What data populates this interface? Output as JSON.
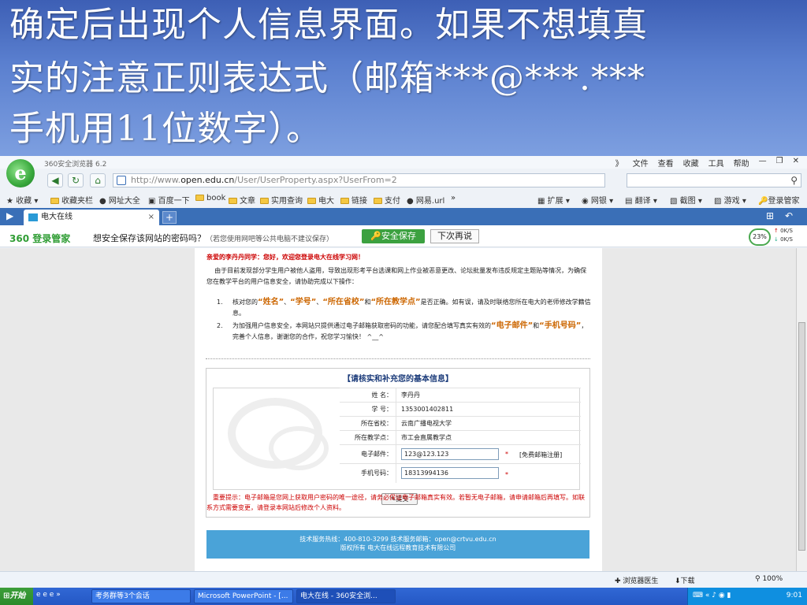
{
  "slide": {
    "line1": "确定后出现个人信息界面。如果不想填真",
    "line2": "实的注意正则表达式（邮箱***@***.***",
    "line3": "手机用11位数字）。"
  },
  "browser": {
    "app_name": "360安全浏览器 6.2",
    "menus": [
      "》",
      "文件",
      "查看",
      "收藏",
      "工具",
      "帮助"
    ],
    "url_prefix": "http://www.",
    "url_host": "open.edu.cn",
    "url_path": "/User/UserProperty.aspx?UserFrom=2",
    "search_placeholder": ""
  },
  "favbar": {
    "items": [
      "收藏",
      "收藏夹栏",
      "网址大全",
      "百度一下",
      "book",
      "文章",
      "实用查询",
      "电大",
      "链接",
      "支付",
      "网易.url",
      "»"
    ],
    "right_items": [
      "扩展",
      "网银",
      "翻译",
      "截图",
      "游戏",
      "登录管家"
    ]
  },
  "tab": {
    "label": "电大在线",
    "close": "×",
    "new": "+"
  },
  "notify": {
    "brand": "360 登录管家",
    "message": "想安全保存该网站的密码吗？",
    "hint": "（若您使用网吧等公共电脑不建议保存）",
    "save_label": "安全保存",
    "later_label": "下次再说",
    "speed_percent": "23%",
    "up_rate": "0K/S",
    "down_rate": "0K/S"
  },
  "page": {
    "welcome": "亲爱的李丹丹同学：您好，欢迎您登录电大在线学习网！",
    "intro": "由于目前发现部分学生用户被他人盗用，导致出现形考平台选课和网上作业被恶意更改、论坛批量发布违反规定主题贴等情况，为确保您在教学平台的用户信息安全，请协助完成以下操作：",
    "item1_num": "1.",
    "item1_a": "核对您的",
    "item1_b": "“姓名”",
    "item1_c": "、",
    "item1_d": "“学号”",
    "item1_e": "、",
    "item1_f": "“所在省校”",
    "item1_g": "和",
    "item1_h": "“所在教学点”",
    "item1_i": "是否正确。如有误，请及时联络您所在电大的老师修改学籍信息。",
    "item2_num": "2.",
    "item2_a": "为加强用户信息安全，本网站只提供通过电子邮箱获取密码的功能，请您配合填写真实有效的",
    "item2_b": "“电子邮件”",
    "item2_c": "和",
    "item2_d": "“手机号码”",
    "item2_e": "，完善个人信息，谢谢您的合作，祝您学习愉快！ ^__^",
    "form_title": "【请核实和补充您的基本信息】",
    "fields": {
      "name_label": "姓  名：",
      "name_value": "李丹丹",
      "id_label": "学  号：",
      "id_value": "1353001402811",
      "province_label": "所在省校：",
      "province_value": "云南广播电视大学",
      "center_label": "所在教学点：",
      "center_value": "市工会直属教学点",
      "email_label": "电子邮件：",
      "email_value": "123@123.123",
      "email_required": "*",
      "email_register": "[免费邮箱注册]",
      "phone_label": "手机号码：",
      "phone_value": "18313994136",
      "phone_required": "*"
    },
    "submit_label": "提交",
    "important": "重要提示：电子邮箱是您网上获取用户密码的唯一途径，请务必保证电子邮箱真实有效。若暂无电子邮箱，请申请邮箱后再填写。如联系方式需要变更，请登录本网站后修改个人资料。",
    "footer_line1": "技术服务热线：400-810-3299    技术服务邮箱：open@crtvu.edu.cn",
    "footer_line2": "版权所有 电大在线远程教育技术有限公司"
  },
  "statusbar": {
    "doctor": "浏览器医生",
    "download": "下载",
    "zoom": "100%"
  },
  "taskbar": {
    "start": "开始",
    "tasks": [
      "考务群等3个会话",
      "Microsoft PowerPoint - [...",
      "电大在线 - 360安全浏..."
    ],
    "clock": "9:01"
  }
}
